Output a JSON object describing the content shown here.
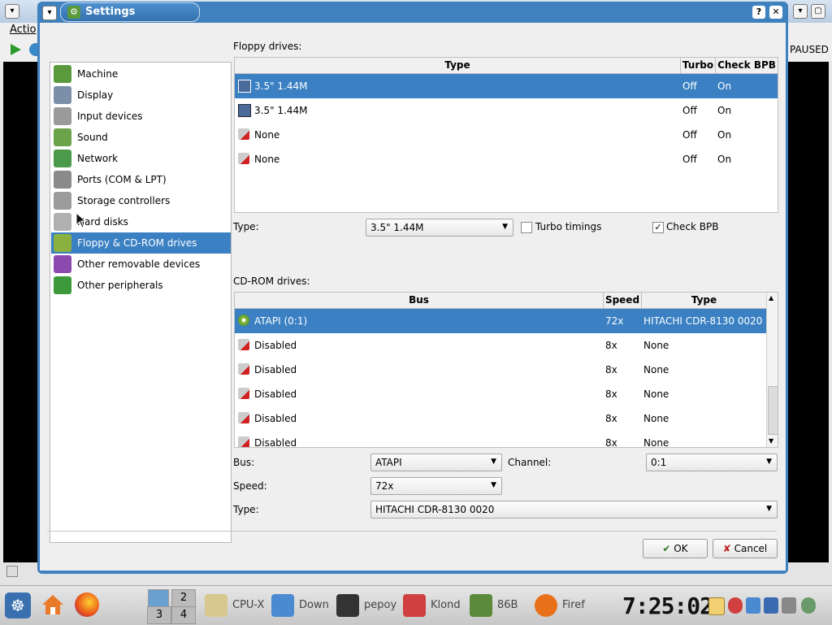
{
  "background_app": {
    "menu_text": "Actio",
    "status_text": "PAUSED"
  },
  "dialog": {
    "title": "Settings",
    "categories": [
      {
        "label": "Machine",
        "icon": "machine-icon",
        "color": "#5a9a3c"
      },
      {
        "label": "Display",
        "icon": "display-icon",
        "color": "#7c8fa8"
      },
      {
        "label": "Input devices",
        "icon": "input-devices-icon",
        "color": "#9a9a9a"
      },
      {
        "label": "Sound",
        "icon": "sound-icon",
        "color": "#6aa34a"
      },
      {
        "label": "Network",
        "icon": "network-icon",
        "color": "#4a9a4a"
      },
      {
        "label": "Ports (COM & LPT)",
        "icon": "ports-icon",
        "color": "#8a8a8a"
      },
      {
        "label": "Storage controllers",
        "icon": "storage-controllers-icon",
        "color": "#9c9c9c"
      },
      {
        "label": "Hard disks",
        "icon": "hard-disk-icon",
        "color": "#b0b0b0"
      },
      {
        "label": "Floppy & CD-ROM drives",
        "icon": "floppy-cdrom-icon",
        "color": "#8ab040"
      },
      {
        "label": "Other removable devices",
        "icon": "removable-devices-icon",
        "color": "#8a4ab0"
      },
      {
        "label": "Other peripherals",
        "icon": "peripherals-icon",
        "color": "#3c9a3c"
      }
    ],
    "floppy": {
      "section_label": "Floppy drives:",
      "columns": [
        "Type",
        "Turbo",
        "Check BPB"
      ],
      "rows": [
        {
          "type": "3.5\" 1.44M",
          "turbo": "Off",
          "bpb": "On",
          "icon": "floppy-disk-icon"
        },
        {
          "type": "3.5\" 1.44M",
          "turbo": "Off",
          "bpb": "On",
          "icon": "floppy-disk-icon"
        },
        {
          "type": "None",
          "turbo": "Off",
          "bpb": "On",
          "icon": "disabled-drive-icon"
        },
        {
          "type": "None",
          "turbo": "Off",
          "bpb": "On",
          "icon": "disabled-drive-icon"
        }
      ],
      "type_label": "Type:",
      "type_value": "3.5\" 1.44M",
      "turbo_label": "Turbo timings",
      "turbo_checked": false,
      "bpb_label": "Check BPB",
      "bpb_checked": true
    },
    "cdrom": {
      "section_label": "CD-ROM drives:",
      "columns": [
        "Bus",
        "Speed",
        "Type"
      ],
      "rows": [
        {
          "bus": "ATAPI (0:1)",
          "speed": "72x",
          "type": "HITACHI CDR-8130 0020",
          "icon": "cdrom-icon"
        },
        {
          "bus": "Disabled",
          "speed": "8x",
          "type": "None",
          "icon": "disabled-drive-icon"
        },
        {
          "bus": "Disabled",
          "speed": "8x",
          "type": "None",
          "icon": "disabled-drive-icon"
        },
        {
          "bus": "Disabled",
          "speed": "8x",
          "type": "None",
          "icon": "disabled-drive-icon"
        },
        {
          "bus": "Disabled",
          "speed": "8x",
          "type": "None",
          "icon": "disabled-drive-icon"
        },
        {
          "bus": "Disabled",
          "speed": "8x",
          "type": "None",
          "icon": "disabled-drive-icon"
        }
      ],
      "bus_label": "Bus:",
      "bus_value": "ATAPI",
      "channel_label": "Channel:",
      "channel_value": "0:1",
      "speed_label": "Speed:",
      "speed_value": "72x",
      "type_label": "Type:",
      "type_value": "HITACHI CDR-8130 0020"
    },
    "buttons": {
      "ok": "OK",
      "cancel": "Cancel"
    },
    "colors": {
      "accent": "#3a80c2",
      "titlebar": "#3f80bf"
    }
  },
  "taskbar": {
    "pager": [
      "2",
      "3",
      "4"
    ],
    "tasks": [
      {
        "label": "CPU-X",
        "icon": "cpu-x-icon"
      },
      {
        "label": "Down",
        "icon": "downloads-icon"
      },
      {
        "label": "pepoy",
        "icon": "terminal-icon"
      },
      {
        "label": "Klond",
        "icon": "klondike-icon"
      },
      {
        "label": "86B",
        "icon": "emulator-icon"
      },
      {
        "label": "Firef",
        "icon": "firefox-icon"
      }
    ],
    "clock": "7:25:02"
  }
}
